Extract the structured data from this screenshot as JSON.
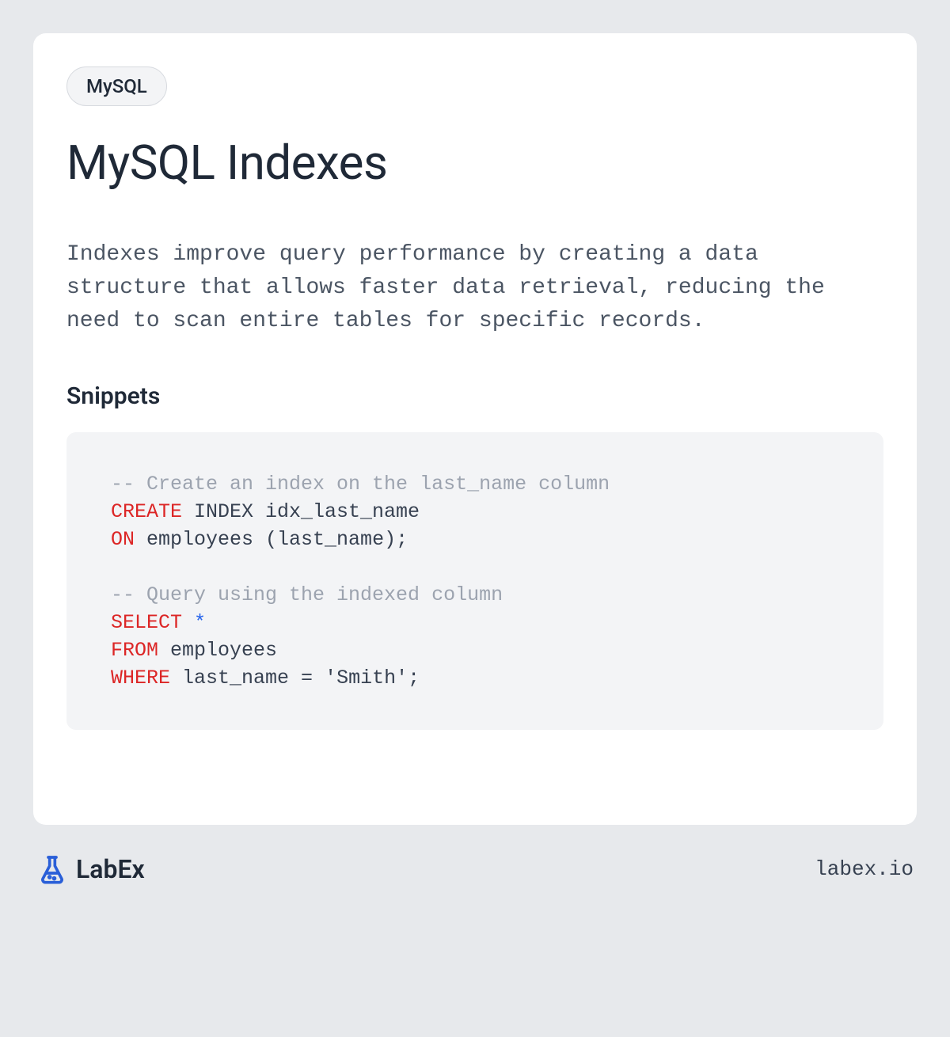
{
  "tag": "MySQL",
  "title": "MySQL Indexes",
  "description": "Indexes improve query performance by creating a data structure that allows faster data retrieval, reducing the need to scan entire tables for specific records.",
  "snippets_heading": "Snippets",
  "code": {
    "tokens": [
      {
        "cls": "comment",
        "text": "-- Create an index on the last_name column"
      },
      {
        "cls": "newline"
      },
      {
        "cls": "keyword",
        "text": "CREATE"
      },
      {
        "cls": "default",
        "text": " INDEX idx_last_name"
      },
      {
        "cls": "newline"
      },
      {
        "cls": "keyword",
        "text": "ON"
      },
      {
        "cls": "default",
        "text": " employees (last_name);"
      },
      {
        "cls": "newline"
      },
      {
        "cls": "newline"
      },
      {
        "cls": "comment",
        "text": "-- Query using the indexed column"
      },
      {
        "cls": "newline"
      },
      {
        "cls": "keyword",
        "text": "SELECT"
      },
      {
        "cls": "default",
        "text": " "
      },
      {
        "cls": "star",
        "text": "*"
      },
      {
        "cls": "newline"
      },
      {
        "cls": "keyword",
        "text": "FROM"
      },
      {
        "cls": "default",
        "text": " employees"
      },
      {
        "cls": "newline"
      },
      {
        "cls": "keyword",
        "text": "WHERE"
      },
      {
        "cls": "default",
        "text": " last_name "
      },
      {
        "cls": "operator",
        "text": "="
      },
      {
        "cls": "default",
        "text": " "
      },
      {
        "cls": "string",
        "text": "'Smith'"
      },
      {
        "cls": "default",
        "text": ";"
      }
    ]
  },
  "footer": {
    "brand": "LabEx",
    "url": "labex.io"
  }
}
